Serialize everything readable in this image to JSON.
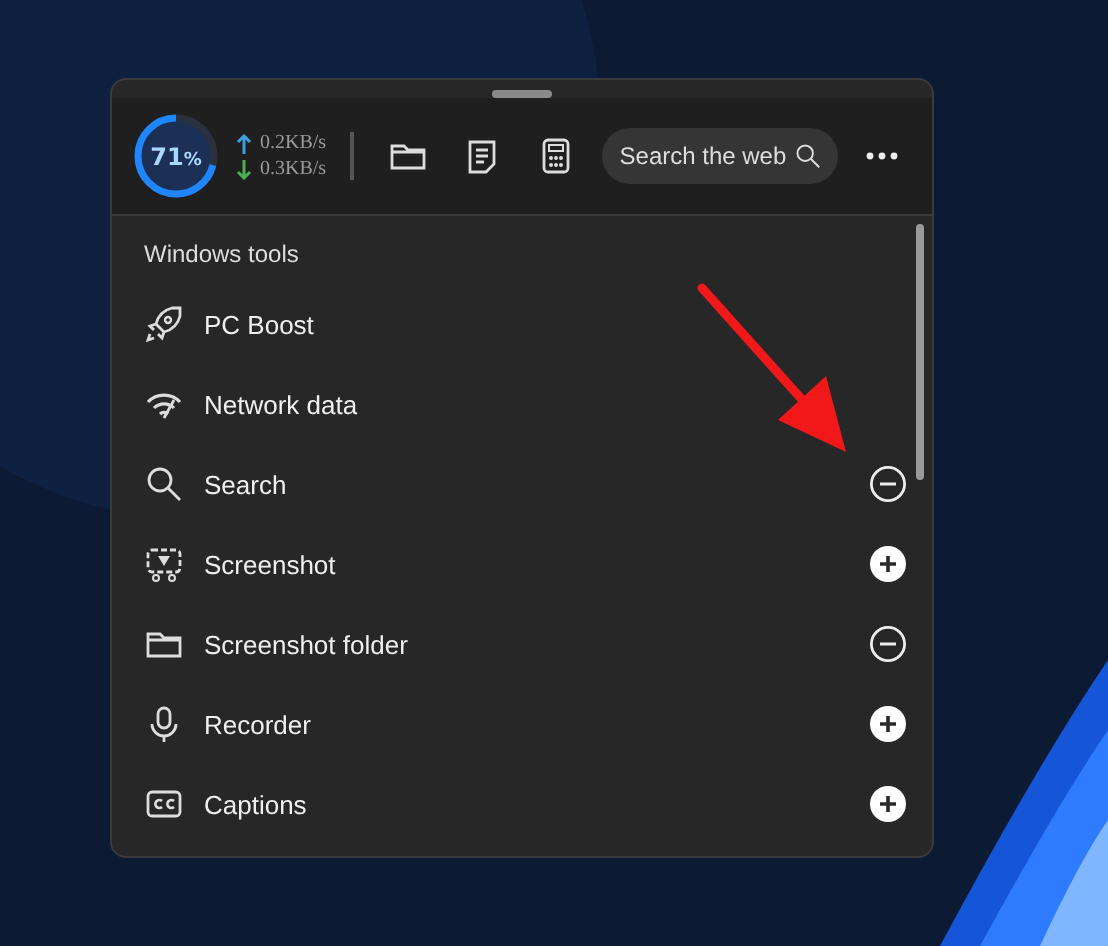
{
  "header": {
    "gauge": {
      "value": "71",
      "unit": "%",
      "level": 0.71
    },
    "upload": "0.2KB/s",
    "download": "0.3KB/s",
    "search": {
      "placeholder": "Search the web"
    }
  },
  "section": {
    "title": "Windows tools"
  },
  "tools": [
    {
      "label": "PC Boost"
    },
    {
      "label": "Network data"
    },
    {
      "label": "Search",
      "added": true
    },
    {
      "label": "Screenshot",
      "added": false
    },
    {
      "label": "Screenshot folder",
      "added": true
    },
    {
      "label": "Recorder",
      "added": false
    },
    {
      "label": "Captions",
      "added": false
    }
  ]
}
